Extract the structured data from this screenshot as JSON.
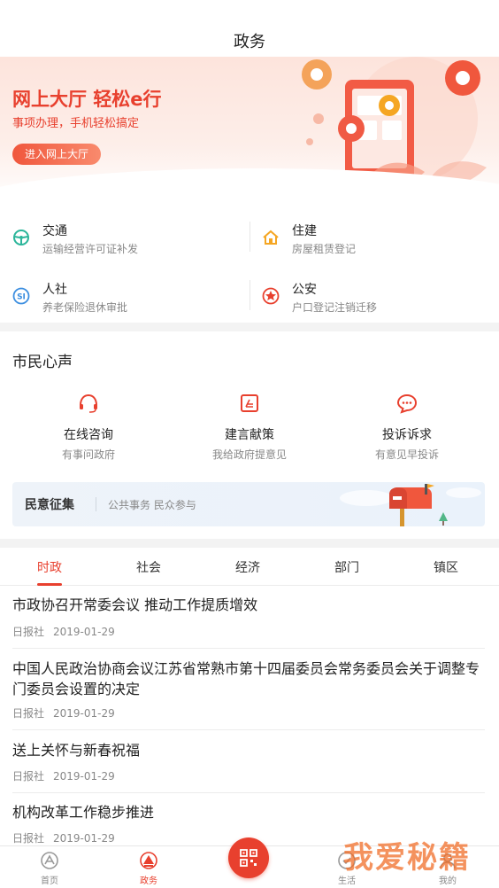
{
  "header": {
    "title": "政务"
  },
  "banner": {
    "headline": "网上大厅 轻松e行",
    "subtitle": "事项办理，手机轻松搞定",
    "enter_label": "进入网上大厅"
  },
  "services": [
    {
      "name": "交通",
      "desc": "运输经营许可证补发",
      "icon": "steering-wheel-icon",
      "color": "#2bb59a"
    },
    {
      "name": "住建",
      "desc": "房屋租赁登记",
      "icon": "house-icon",
      "color": "#f5a623"
    },
    {
      "name": "人社",
      "desc": "养老保险退休审批",
      "icon": "social-security-icon",
      "color": "#3d8fe0"
    },
    {
      "name": "公安",
      "desc": "户口登记注销迁移",
      "icon": "police-badge-icon",
      "color": "#e8402e"
    }
  ],
  "citizen_voice": {
    "title": "市民心声",
    "items": [
      {
        "name": "在线咨询",
        "desc": "有事问政府",
        "icon": "headset-icon"
      },
      {
        "name": "建言献策",
        "desc": "我给政府提意见",
        "icon": "suggestion-icon"
      },
      {
        "name": "投诉诉求",
        "desc": "有意见早投诉",
        "icon": "chat-bubble-icon"
      }
    ],
    "collect": {
      "title": "民意征集",
      "desc": "公共事务 民众参与"
    }
  },
  "news_tabs": {
    "items": [
      "时政",
      "社会",
      "经济",
      "部门",
      "镇区"
    ],
    "active_index": 0
  },
  "news": [
    {
      "title": "市政协召开常委会议 推动工作提质增效",
      "source": "日报社",
      "date": "2019-01-29"
    },
    {
      "title": "中国人民政治协商会议江苏省常熟市第十四届委员会常务委员会关于调整专门委员会设置的决定",
      "source": "日报社",
      "date": "2019-01-29"
    },
    {
      "title": "送上关怀与新春祝福",
      "source": "日报社",
      "date": "2019-01-29"
    },
    {
      "title": "机构改革工作稳步推进",
      "source": "日报社",
      "date": "2019-01-29"
    }
  ],
  "bottom_nav": {
    "items": [
      {
        "label": "首页",
        "icon": "home-icon"
      },
      {
        "label": "政务",
        "icon": "government-icon"
      },
      {
        "label": "",
        "icon": "qr-scan-icon"
      },
      {
        "label": "生活",
        "icon": "life-icon"
      },
      {
        "label": "我的",
        "icon": "profile-icon"
      }
    ],
    "active_index": 1
  },
  "watermark": "我爱秘籍",
  "colors": {
    "accent": "#e8402e",
    "muted_text": "#888888",
    "divider": "#ececec"
  }
}
